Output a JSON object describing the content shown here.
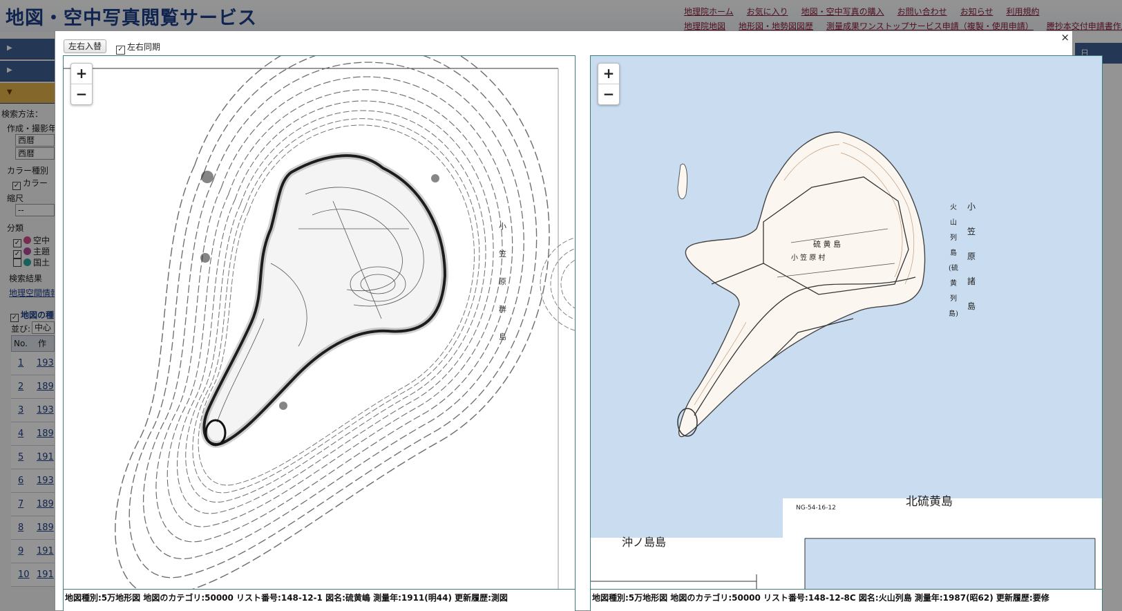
{
  "site": {
    "title": "地図・空中写真閲覧サービス",
    "links_row1": [
      "地理院ホーム",
      "お気に入り",
      "地図・空中写真の購入",
      "お問い合わせ",
      "お知らせ",
      "利用規約"
    ],
    "links_row2": [
      "地理院地図",
      "地形図・地勢図図歴",
      "測量成果ワンストップサービス申請（複製・使用申請）",
      "謄抄本交付申請書作成"
    ]
  },
  "sidebar": {
    "search_method_label": "検索方法：",
    "date_label": "作成・撮影年",
    "era_values": [
      "西暦",
      "西暦"
    ],
    "color_label": "カラー種別",
    "color_checkbox": "カラー",
    "scale_label": "縮尺",
    "scale_value": "--",
    "category_label": "分類",
    "categories": [
      {
        "label": "空中",
        "color": "#d24a8a",
        "checked": "✓"
      },
      {
        "label": "主題",
        "color": "#b04a9a",
        "checked": "✓"
      },
      {
        "label": "国土",
        "color": "#2aa7a0",
        "checked": ""
      }
    ],
    "result_label": "検索結果",
    "result_link": "地理空間情報",
    "map_type_hdr": "地図の種",
    "sort_label": "並び:",
    "sort_value": "中心",
    "table_headers": [
      "No.",
      "作成"
    ],
    "rows": [
      {
        "n": "1",
        "y": "193"
      },
      {
        "n": "2",
        "y": "189"
      },
      {
        "n": "3",
        "y": "193"
      },
      {
        "n": "4",
        "y": "189"
      },
      {
        "n": "5",
        "y": "191"
      },
      {
        "n": "6",
        "y": "193"
      },
      {
        "n": "7",
        "y": "189"
      },
      {
        "n": "8",
        "y": "189"
      },
      {
        "n": "9",
        "y": "191"
      },
      {
        "n": "10",
        "y": "191"
      }
    ],
    "right_edge_text": "日"
  },
  "modal": {
    "close_glyph": "×",
    "swap_label": "左右入替",
    "sync_label": "左右同期",
    "sync_checked": "✓",
    "zoom_in": "+",
    "zoom_out": "−",
    "left": {
      "caption": "地図種別:5万地形図 地図のカテゴリ:50000 リスト番号:148-12-1 図名:硫黄嶋 測量年:1911(明44) 更新履歴:測図",
      "map_labels": [
        "小",
        "笠",
        "原",
        "群",
        "島"
      ]
    },
    "right": {
      "caption": "地図種別:5万地形図 地図のカテゴリ:50000 リスト番号:148-12-8C 図名:火山列島 測量年:1987(昭62) 更新履歴:要修",
      "labels": {
        "island_main": "硫 黄 島",
        "village": "小 笠 原 村",
        "kita": "北硫黄島",
        "okinotori": "沖ノ島島",
        "sheet_code": "NG-54-16-12",
        "group_col1": [
          "小",
          "笠",
          "原",
          "諸",
          "島"
        ],
        "group_col2": [
          "火",
          "山",
          "列",
          "島",
          "(硫",
          "黄",
          "列",
          "島)"
        ]
      },
      "sea_color": "#c9dcf0",
      "land_color": "#fbf7f0"
    }
  }
}
